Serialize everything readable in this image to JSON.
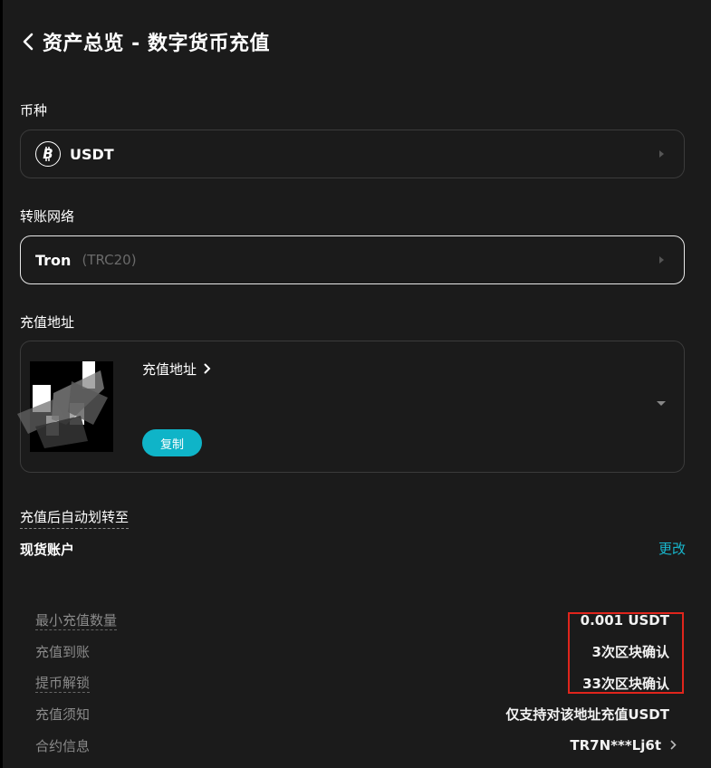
{
  "header": {
    "title": "资产总览 - 数字货币充值"
  },
  "coin": {
    "label": "币种",
    "value": "USDT"
  },
  "network": {
    "label": "转账网络",
    "value": "Tron",
    "sub": "(TRC20)"
  },
  "address": {
    "label": "充值地址",
    "card_title": "充值地址",
    "copy_label": "复制"
  },
  "transfer": {
    "label": "充值后自动划转至",
    "account": "现货账户",
    "change_label": "更改"
  },
  "info": [
    {
      "label": "最小充值数量",
      "value": "0.001 USDT"
    },
    {
      "label": "充值到账",
      "value": "3次区块确认"
    },
    {
      "label": "提币解锁",
      "value": "33次区块确认"
    },
    {
      "label": "充值须知",
      "value": "仅支持对该地址充值USDT"
    },
    {
      "label": "合约信息",
      "value": "TR7N***Lj6t"
    }
  ],
  "colors": {
    "accent": "#0fb4c8",
    "highlight": "#e0251c",
    "background": "#1b1b1b"
  }
}
